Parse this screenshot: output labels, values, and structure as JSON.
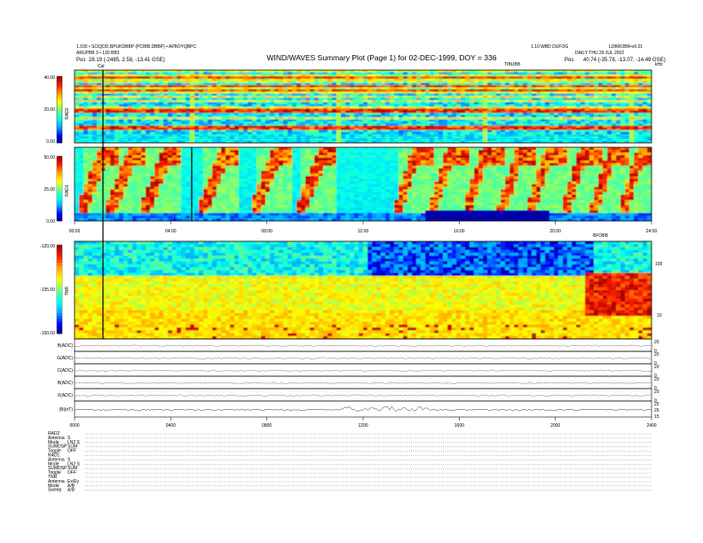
{
  "header": {
    "title": "WIND/WAVES Summary Plot (Page 1) for 02-DEC-1999, DOY = 336",
    "left_line1": "1.030 • SCIQDD.BPUKDBBP (PCIBB.DBBP) • AFBOYQBPC",
    "left_line2": "ARUPBB 3 • 130 BB3",
    "left_pos_label": "Pos",
    "left_pos_value": "28.19 (-2485, 2.58, -13.41 GSE)",
    "right_line1": "1.10 WBD DUFOG",
    "right_line2": "LDBROBR•v6.01",
    "right_line3": "DAILY THU 29 JUL 2002",
    "right_pos_label": "Pos",
    "right_pos_value": "40.74 (-35.78, -13.07, -14.49 GSE)",
    "cal_label": "Cal",
    "rad2_right_tag": "TIBUBB",
    "rad1_right_tag": "BFOBB",
    "units_right": "kHz"
  },
  "footer": {
    "rows": [
      {
        "k": "RAD2",
        "v": ""
      },
      {
        "k": "Antenna",
        "v": "S"
      },
      {
        "k": "Mode",
        "v": "LN2 S"
      },
      {
        "k": "SUMDSP",
        "v": "SUM"
      },
      {
        "k": "Toggle",
        "v": "OFF"
      },
      {
        "k": "RAD1",
        "v": ""
      },
      {
        "k": "Antenna",
        "v": "S"
      },
      {
        "k": "Mode",
        "v": "LN2 S"
      },
      {
        "k": "SUMDSP",
        "v": "SUM"
      },
      {
        "k": "Toggle",
        "v": "OFF"
      },
      {
        "k": "TNR",
        "v": ""
      },
      {
        "k": "Antenna",
        "v": "Ex/Ey"
      },
      {
        "k": "Mode",
        "v": "A/B"
      },
      {
        "k": "Sweep",
        "v": "A/B"
      }
    ]
  },
  "colors": {
    "colormap": [
      "#00007a",
      "#0000ff",
      "#00aaff",
      "#00ffee",
      "#66ff88",
      "#ffff00",
      "#ffaa00",
      "#ff2200",
      "#aa0000"
    ],
    "background": "#ffffff",
    "axis": "#000000"
  },
  "chart_data": [
    {
      "type": "heatmap",
      "panel": "RAD2",
      "ylabel": "RAD2",
      "x_range": [
        "00:00",
        "24:00"
      ],
      "y_ticks": [
        "40.00",
        "20.00",
        "0.00"
      ],
      "color_scale": "dB above background"
    },
    {
      "type": "heatmap",
      "panel": "RAD1",
      "ylabel": "RAD1",
      "x_range": [
        "00:00",
        "24:00"
      ],
      "y_ticks": [
        "50.00",
        "25.00",
        "0.00"
      ],
      "x_ticks": [
        "00:00",
        "04:00",
        "08:00",
        "12:00",
        "16:00",
        "20:00",
        "24:00"
      ]
    },
    {
      "type": "heatmap",
      "panel": "TNR",
      "ylabel": "TNR",
      "x_range": [
        "00:00",
        "24:00"
      ],
      "y_ticks": [
        "-120.00",
        "-135.00",
        "-150.00"
      ],
      "right_ticks": [
        "100",
        "10"
      ]
    },
    {
      "type": "line",
      "panels": [
        "B(ADC)",
        "G(ADC)",
        "C(ADC)",
        "B(ADC)",
        "X(ADC)",
        "|B|(nT)"
      ],
      "x_ticks": [
        "0000",
        "0400",
        "0800",
        "1200",
        "1600",
        "2000",
        "2400"
      ],
      "right_ticks": [
        [
          "20",
          "0"
        ],
        [
          "20",
          "0"
        ],
        [
          "20",
          "0"
        ],
        [
          "20",
          "0"
        ],
        [
          "20",
          "0"
        ],
        [
          "25",
          "20",
          "15"
        ]
      ]
    }
  ]
}
